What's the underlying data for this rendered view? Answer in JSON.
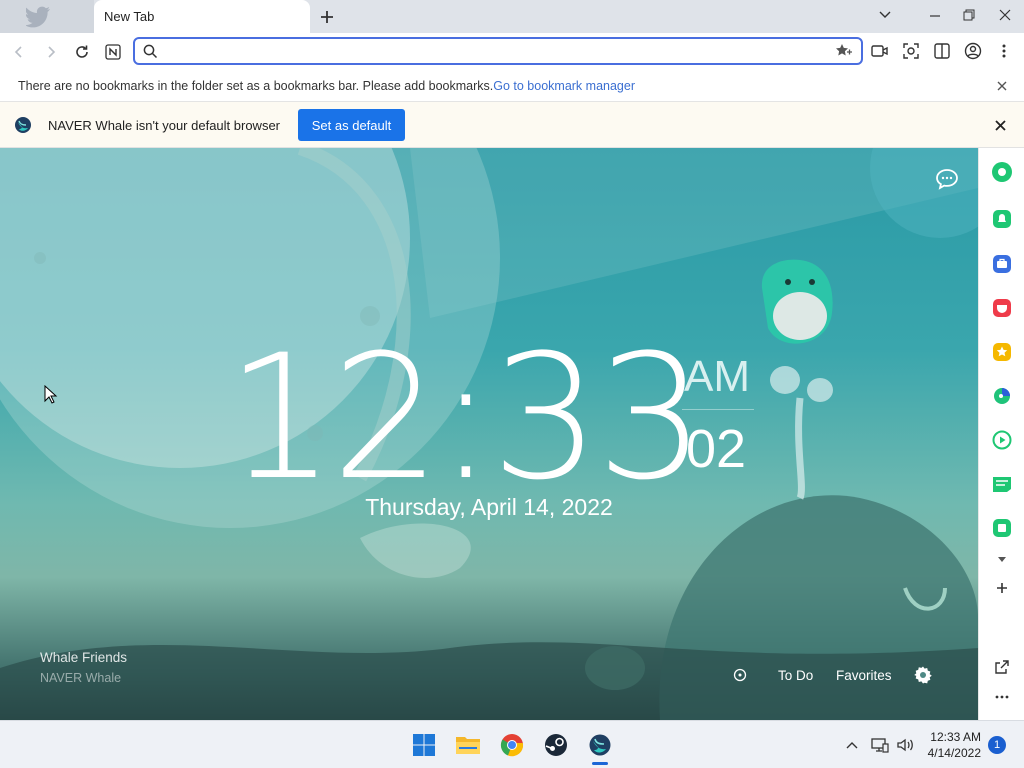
{
  "tabs": [
    {
      "title": "New Tab"
    }
  ],
  "omnibox": {
    "value": "",
    "placeholder": ""
  },
  "bookmarks_bar": {
    "message": "There are no bookmarks in the folder set as a bookmarks bar. Please add bookmarks.",
    "link": "Go to bookmark manager"
  },
  "infobar": {
    "message": "NAVER Whale isn't your default browser",
    "button": "Set as default"
  },
  "clock": {
    "hours_minutes": "12:33",
    "ampm": "AM",
    "seconds": "02",
    "date": "Thursday, April 14, 2022"
  },
  "credit": {
    "title": "Whale Friends",
    "author": "NAVER Whale"
  },
  "bottom_tools": {
    "todo": "To Do",
    "favorites": "Favorites"
  },
  "sidebar": {
    "items": [
      "green-circle-icon",
      "bell-icon",
      "briefcase-icon",
      "pocket-icon",
      "star-icon",
      "papago-icon",
      "play-icon",
      "webtoon-icon",
      "square-icon"
    ]
  },
  "taskbar": {
    "apps": [
      "windows-start-icon",
      "file-explorer-icon",
      "chrome-icon",
      "steam-icon",
      "whale-icon"
    ],
    "time": "12:33 AM",
    "date": "4/14/2022",
    "notification_count": "1"
  },
  "colors": {
    "accent": "#1a73e8",
    "omnibox_border": "#4a6ee0",
    "link": "#3b6fd1"
  }
}
